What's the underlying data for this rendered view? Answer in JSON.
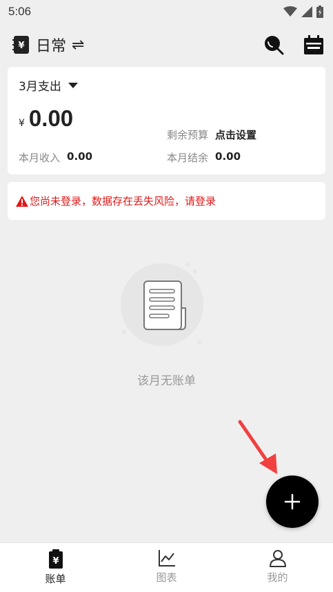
{
  "status_bar": {
    "time": "5:06"
  },
  "app_bar": {
    "book_title": "日常",
    "switch_glyph": "⇌"
  },
  "summary": {
    "month_label": "3月支出",
    "currency": "¥",
    "expense_amount": "0.00",
    "budget_label": "剩余预算",
    "budget_value": "点击设置",
    "income_label": "本月收入",
    "income_value": "0.00",
    "balance_label": "本月结余",
    "balance_value": "0.00"
  },
  "warning": {
    "text": "您尚未登录，数据存在丢失风险，请登录"
  },
  "empty_state": {
    "text": "该月无账单"
  },
  "nav": {
    "items": [
      {
        "label": "账单",
        "icon": "bill-icon",
        "active": true
      },
      {
        "label": "图表",
        "icon": "chart-icon",
        "active": false
      },
      {
        "label": "我的",
        "icon": "profile-icon",
        "active": false
      }
    ]
  },
  "colors": {
    "warning": "#e01818",
    "accent": "#000000",
    "arrow": "#f04040",
    "background": "#efefef"
  }
}
